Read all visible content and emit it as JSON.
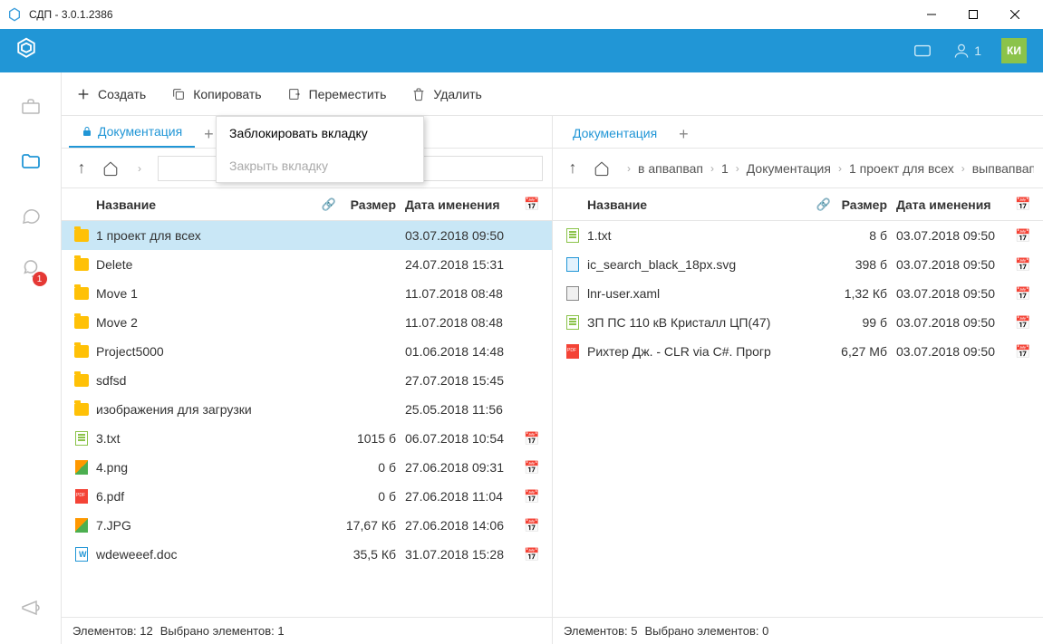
{
  "window": {
    "title": "СДП - 3.0.1.2386"
  },
  "header": {
    "user_count": "1",
    "avatar": "КИ"
  },
  "sidebar": {
    "chat_badge": "1"
  },
  "toolbar": {
    "create": "Создать",
    "copy": "Копировать",
    "move": "Переместить",
    "delete": "Удалить"
  },
  "context_menu": {
    "lock": "Заблокировать вкладку",
    "close": "Закрыть вкладку"
  },
  "left": {
    "tab": "Документация",
    "headers": {
      "name": "Название",
      "size": "Размер",
      "date": "Дата именения"
    },
    "rows": [
      {
        "type": "folder",
        "name": "1 проект для всех",
        "size": "",
        "date": "03.07.2018 09:50",
        "cal": "",
        "selected": true
      },
      {
        "type": "folder",
        "name": "Delete",
        "size": "",
        "date": "24.07.2018 15:31",
        "cal": ""
      },
      {
        "type": "folder",
        "name": "Move 1",
        "size": "",
        "date": "11.07.2018 08:48",
        "cal": ""
      },
      {
        "type": "folder",
        "name": "Move 2",
        "size": "",
        "date": "11.07.2018 08:48",
        "cal": ""
      },
      {
        "type": "folder",
        "name": "Project5000",
        "size": "",
        "date": "01.06.2018 14:48",
        "cal": ""
      },
      {
        "type": "folder",
        "name": "sdfsd",
        "size": "",
        "date": "27.07.2018 15:45",
        "cal": ""
      },
      {
        "type": "folder",
        "name": "изображения для загрузки",
        "size": "",
        "date": "25.05.2018 11:56",
        "cal": ""
      },
      {
        "type": "txt",
        "name": "3.txt",
        "size": "1015 б",
        "date": "06.07.2018 10:54",
        "cal": "📅"
      },
      {
        "type": "img",
        "name": "4.png",
        "size": "0 б",
        "date": "27.06.2018 09:31",
        "cal": "📅"
      },
      {
        "type": "pdf",
        "name": "6.pdf",
        "size": "0 б",
        "date": "27.06.2018 11:04",
        "cal": "📅"
      },
      {
        "type": "img",
        "name": "7.JPG",
        "size": "17,67 Кб",
        "date": "27.06.2018 14:06",
        "cal": "📅"
      },
      {
        "type": "doc",
        "name": "wdeweeef.doc",
        "size": "35,5 Кб",
        "date": "31.07.2018 15:28",
        "cal": "📅"
      }
    ],
    "status_items": "Элементов: 12",
    "status_selected": "Выбрано элементов: 1"
  },
  "right": {
    "tab": "Документация",
    "crumbs": [
      "в апвапвап",
      "1",
      "Документация",
      "1 проект для всех",
      "выпвапвап"
    ],
    "headers": {
      "name": "Название",
      "size": "Размер",
      "date": "Дата именения"
    },
    "rows": [
      {
        "type": "txt",
        "name": "1.txt",
        "size": "8 б",
        "date": "03.07.2018 09:50",
        "cal": "📅"
      },
      {
        "type": "svg",
        "name": "ic_search_black_18px.svg",
        "size": "398 б",
        "date": "03.07.2018 09:50",
        "cal": "📅"
      },
      {
        "type": "xaml",
        "name": "lnr-user.xaml",
        "size": "1,32 Кб",
        "date": "03.07.2018 09:50",
        "cal": "📅"
      },
      {
        "type": "txt",
        "name": "ЗП ПС 110 кВ Кристалл ЦП(47)",
        "size": "99 б",
        "date": "03.07.2018 09:50",
        "cal": "📅"
      },
      {
        "type": "pdf",
        "name": "Рихтер Дж. - CLR via C#. Прогр",
        "size": "6,27 Мб",
        "date": "03.07.2018 09:50",
        "cal": "📅"
      }
    ],
    "status_items": "Элементов: 5",
    "status_selected": "Выбрано элементов: 0"
  }
}
